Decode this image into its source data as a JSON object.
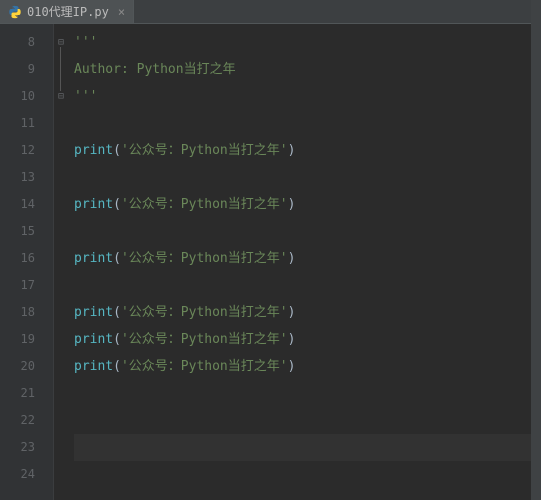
{
  "tab": {
    "filename": "010代理IP.py",
    "icon": "python-icon"
  },
  "editor": {
    "first_line_number": 8,
    "current_line": 23,
    "fold_markers": [
      {
        "line": 8,
        "glyph": "⊟"
      },
      {
        "line": 10,
        "glyph": "⊟"
      }
    ],
    "fold_line": {
      "from": 8,
      "to": 10
    },
    "lines": [
      {
        "n": 8,
        "kind": "docstring_quote"
      },
      {
        "n": 9,
        "kind": "docstring_text",
        "text": "Author: Python当打之年"
      },
      {
        "n": 10,
        "kind": "docstring_quote"
      },
      {
        "n": 11,
        "kind": "blank"
      },
      {
        "n": 12,
        "kind": "print",
        "arg": "'公众号：Python当打之年'"
      },
      {
        "n": 13,
        "kind": "blank"
      },
      {
        "n": 14,
        "kind": "print",
        "arg": "'公众号：Python当打之年'"
      },
      {
        "n": 15,
        "kind": "blank"
      },
      {
        "n": 16,
        "kind": "print",
        "arg": "'公众号：Python当打之年'"
      },
      {
        "n": 17,
        "kind": "blank"
      },
      {
        "n": 18,
        "kind": "print",
        "arg": "'公众号：Python当打之年'"
      },
      {
        "n": 19,
        "kind": "print",
        "arg": "'公众号：Python当打之年'"
      },
      {
        "n": 20,
        "kind": "print",
        "arg": "'公众号：Python当打之年'"
      },
      {
        "n": 21,
        "kind": "blank"
      },
      {
        "n": 22,
        "kind": "blank"
      },
      {
        "n": 23,
        "kind": "blank"
      },
      {
        "n": 24,
        "kind": "blank"
      }
    ]
  },
  "strings": {
    "triple_quote": "'''",
    "print_fn": "print"
  }
}
